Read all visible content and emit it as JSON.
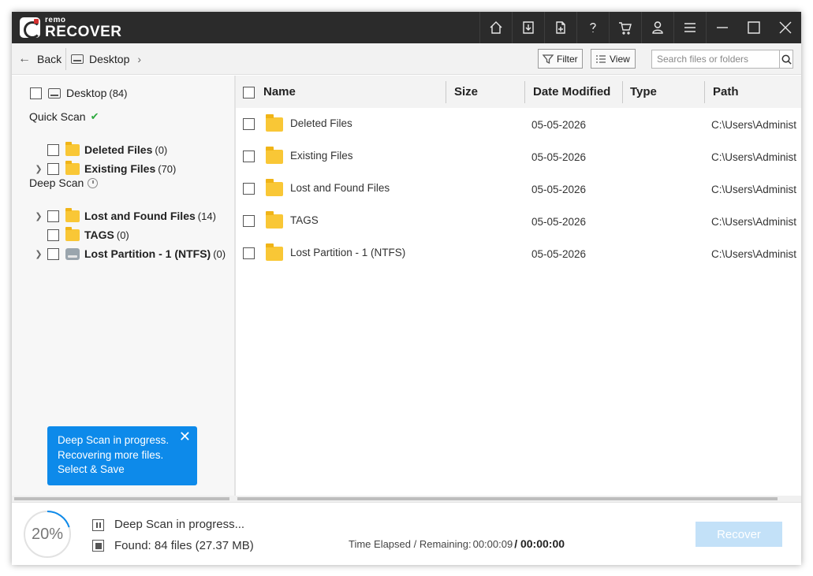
{
  "app": {
    "logo_small": "remo",
    "logo_big": "RECOVER"
  },
  "titlebar": {
    "icons": [
      "home-icon",
      "download-icon",
      "add-file-icon",
      "help-icon",
      "cart-icon",
      "user-icon",
      "menu-icon",
      "minimize-icon",
      "maximize-icon",
      "close-icon"
    ]
  },
  "toolbar": {
    "back_label": "Back",
    "breadcrumb": "Desktop",
    "filter_label": "Filter",
    "view_label": "View",
    "search_placeholder": "Search files or folders"
  },
  "tree": {
    "root": {
      "label": "Desktop",
      "count": "(84)"
    },
    "quick_scan_label": "Quick Scan",
    "deep_scan_label": "Deep Scan",
    "quick_items": [
      {
        "label": "Deleted Files",
        "count": "(0)",
        "expandable": false
      },
      {
        "label": "Existing Files",
        "count": "(70)",
        "expandable": true
      }
    ],
    "deep_items": [
      {
        "label": "Lost and Found Files",
        "count": "(14)",
        "expandable": true
      },
      {
        "label": "TAGS",
        "count": "(0)",
        "expandable": false
      },
      {
        "label": "Lost Partition - 1 (NTFS)",
        "count": "(0)",
        "expandable": true
      }
    ]
  },
  "toast": {
    "line1": "Deep Scan in progress.",
    "line2": "Recovering more files.",
    "line3": "Select & Save"
  },
  "list": {
    "columns": {
      "name": "Name",
      "size": "Size",
      "date": "Date Modified",
      "type": "Type",
      "path": "Path"
    },
    "rows": [
      {
        "name": "Deleted Files",
        "date": "05-05-2026",
        "path": "C:\\Users\\Administ"
      },
      {
        "name": "Existing Files",
        "date": "05-05-2026",
        "path": "C:\\Users\\Administ"
      },
      {
        "name": "Lost and Found Files",
        "date": "05-05-2026",
        "path": "C:\\Users\\Administ"
      },
      {
        "name": "TAGS",
        "date": "05-05-2026",
        "path": "C:\\Users\\Administ"
      },
      {
        "name": "Lost Partition - 1 (NTFS)",
        "date": "05-05-2026",
        "path": "C:\\Users\\Administ"
      }
    ]
  },
  "status": {
    "progress_percent": 20,
    "progress_text": "20%",
    "progress_label": "Deep Scan in progress...",
    "found_label": "Found:",
    "found_value": "84 files (27.37 MB)",
    "time_label": "Time Elapsed / Remaining:",
    "time_elapsed": "00:00:09",
    "time_remaining": "/ 00:00:00",
    "recover_label": "Recover"
  },
  "colors": {
    "titlebar": "#2b2b2b",
    "accent": "#0d8aea",
    "folder": "#f9c736",
    "recover_disabled": "#c3e1f8"
  }
}
